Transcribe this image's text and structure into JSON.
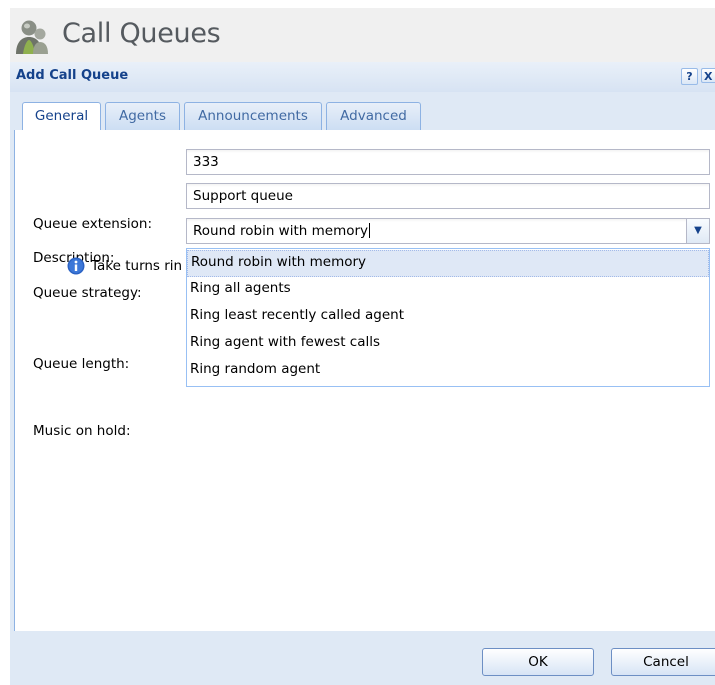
{
  "app": {
    "title": "Call Queues",
    "icon": "user-group-icon"
  },
  "dialog": {
    "title": "Add Call Queue",
    "help_label": "?",
    "close_label": "X"
  },
  "tabs": [
    {
      "label": "General",
      "active": true
    },
    {
      "label": "Agents",
      "active": false
    },
    {
      "label": "Announcements",
      "active": false
    },
    {
      "label": "Advanced",
      "active": false
    }
  ],
  "form": {
    "extension": {
      "label": "Queue extension:",
      "value": "333"
    },
    "description": {
      "label": "Description:",
      "value": "Support queue"
    },
    "strategy": {
      "label": "Queue strategy:",
      "value": "Round robin with memory"
    },
    "hint": "Take turns rin",
    "queue_length": {
      "label": "Queue length:"
    },
    "music_on_hold": {
      "label": "Music on hold:"
    }
  },
  "dropdown": {
    "options": [
      "Round robin with memory",
      "Ring all agents",
      "Ring least recently called agent",
      "Ring agent with fewest calls",
      "Ring random agent"
    ],
    "selected_index": 0
  },
  "buttons": {
    "ok": "OK",
    "cancel": "Cancel"
  },
  "colors": {
    "accent": "#15428b",
    "panel_bg": "#dfe9f5",
    "selected_option": "#dfe8f6"
  }
}
